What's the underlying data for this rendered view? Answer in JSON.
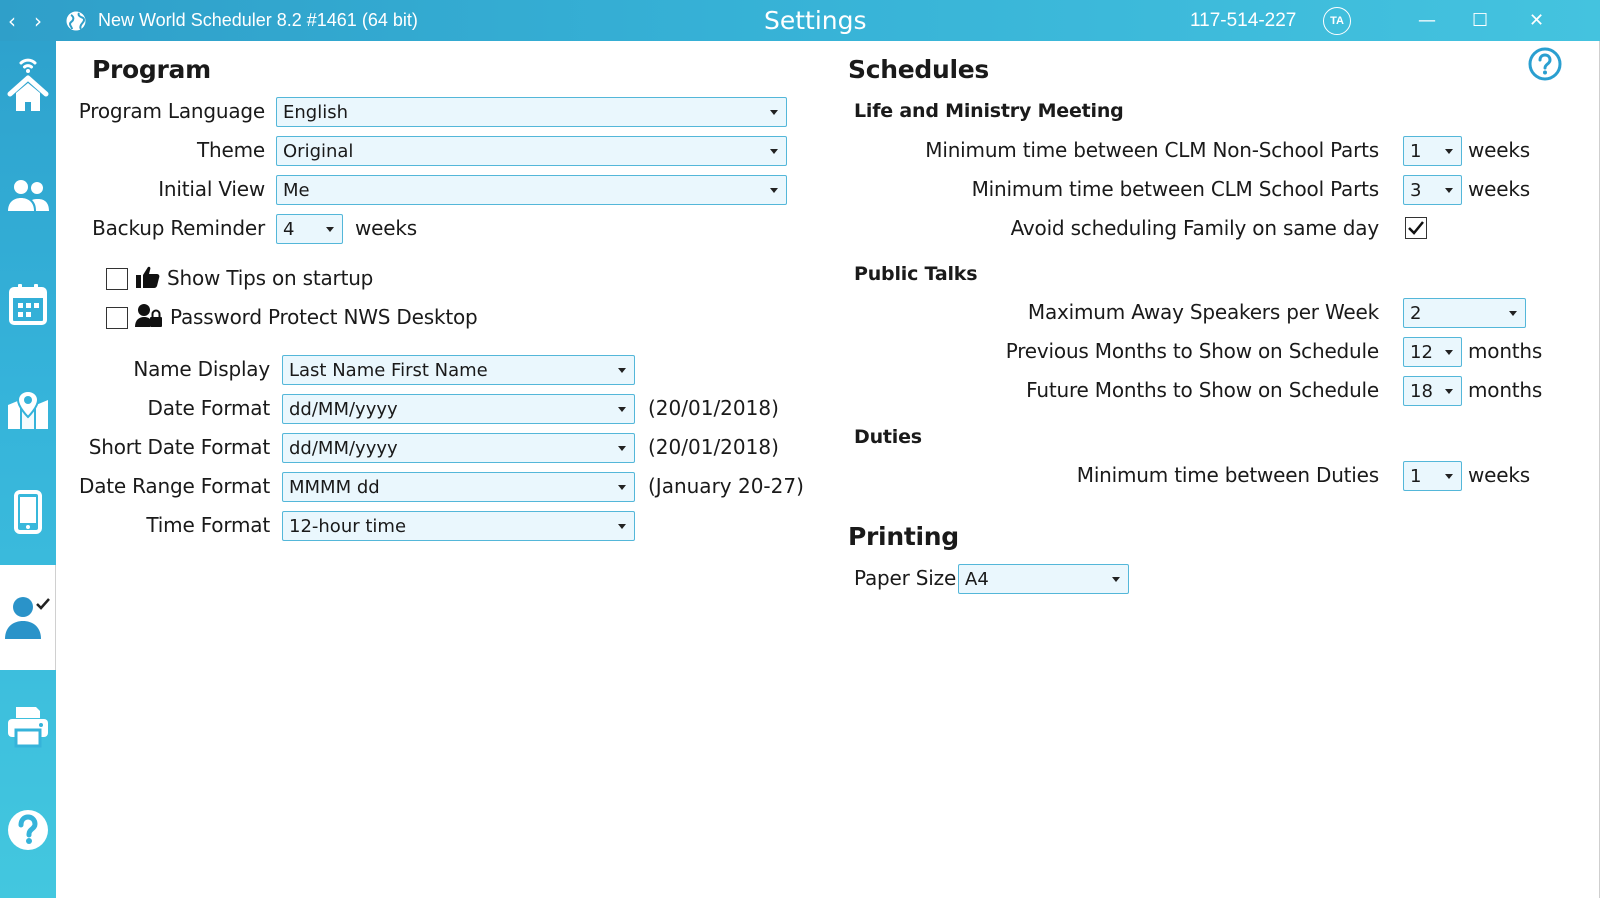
{
  "titlebar": {
    "back_glyph": "‹",
    "forward_glyph": "›",
    "app_title": "New World Scheduler 8.2 #1461 (64 bit)",
    "window_title": "Settings",
    "phone": "117-514-227",
    "badge": "TA",
    "minimize": "—",
    "maximize": "☐",
    "close": "✕"
  },
  "sidebar": {
    "items": [
      {
        "name": "home",
        "icon": "home-icon"
      },
      {
        "name": "people",
        "icon": "people-icon"
      },
      {
        "name": "calendar",
        "icon": "calendar-icon"
      },
      {
        "name": "map",
        "icon": "map-icon"
      },
      {
        "name": "mobile",
        "icon": "mobile-icon"
      },
      {
        "name": "settings-user",
        "icon": "user-check-icon",
        "active": true
      },
      {
        "name": "print",
        "icon": "printer-icon"
      },
      {
        "name": "help",
        "icon": "help-icon"
      }
    ],
    "accent": "#35b3da"
  },
  "program": {
    "heading": "Program",
    "language_label": "Program Language",
    "language_value": "English",
    "theme_label": "Theme",
    "theme_value": "Original",
    "initial_view_label": "Initial View",
    "initial_view_value": "Me",
    "backup_label": "Backup Reminder",
    "backup_value": "4",
    "backup_unit": "weeks",
    "tips_label": "Show Tips on startup",
    "tips_checked": false,
    "password_label": "Password Protect NWS Desktop",
    "password_checked": false,
    "name_display_label": "Name Display",
    "name_display_value": "Last Name First Name",
    "date_format_label": "Date Format",
    "date_format_value": "dd/MM/yyyy",
    "date_format_preview": "(20/01/2018)",
    "short_date_label": "Short Date Format",
    "short_date_value": "dd/MM/yyyy",
    "short_date_preview": "(20/01/2018)",
    "date_range_label": "Date Range Format",
    "date_range_value": "MMMM dd",
    "date_range_preview": "(January 20-27)",
    "time_format_label": "Time Format",
    "time_format_value": "12-hour time"
  },
  "schedules": {
    "heading": "Schedules",
    "clm_heading": "Life and Ministry Meeting",
    "clm_nonschool_label": "Minimum time between CLM Non-School Parts",
    "clm_nonschool_value": "1",
    "clm_nonschool_unit": "weeks",
    "clm_school_label": "Minimum time between CLM School Parts",
    "clm_school_value": "3",
    "clm_school_unit": "weeks",
    "avoid_family_label": "Avoid scheduling Family on same day",
    "avoid_family_checked": true,
    "pt_heading": "Public Talks",
    "max_away_label": "Maximum Away Speakers per Week",
    "max_away_value": "2",
    "prev_months_label": "Previous Months to Show on Schedule",
    "prev_months_value": "12",
    "prev_months_unit": "months",
    "future_months_label": "Future Months to Show on Schedule",
    "future_months_value": "18",
    "future_months_unit": "months",
    "duties_heading": "Duties",
    "duties_label": "Minimum time between Duties",
    "duties_value": "1",
    "duties_unit": "weeks"
  },
  "printing": {
    "heading": "Printing",
    "paper_label": "Paper Size",
    "paper_value": "A4"
  },
  "colors": {
    "titlebar": "#36b1d6",
    "dropdown_border": "#54b7d9",
    "dropdown_fill": "#eaf7fd",
    "help": "#2a9fd0"
  }
}
